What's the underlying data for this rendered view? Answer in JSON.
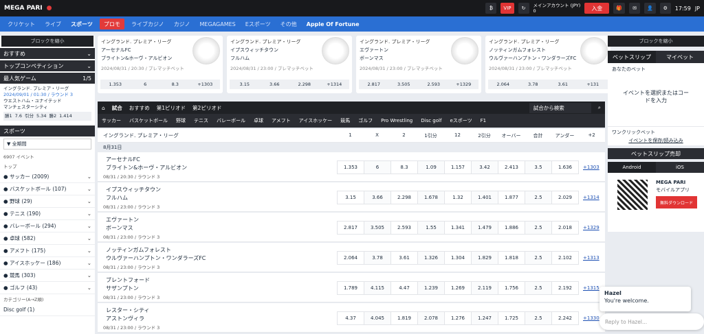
{
  "header": {
    "logo": "MEGA PARI",
    "vip": "VIP",
    "account_label": "メインアカウント (JPY)",
    "account_balance": "0",
    "deposit_button": "入金",
    "time": "17:59",
    "lang": "JP"
  },
  "nav": {
    "items": [
      "クリケット",
      "ライブ",
      "スポーツ",
      "プロモ",
      "ライブカジノ",
      "カジノ",
      "MEGAGAMES",
      "Eスポーツ",
      "その他",
      "Apple Of Fortune"
    ]
  },
  "left": {
    "collapse": "ブロックを縮小",
    "featured": "おすすめ",
    "top_comp": "トップコンペティション",
    "popular": "最人気ゲーム",
    "popular_pager": "1/5",
    "popular_match": {
      "league": "イングランド. プレミア・リーグ",
      "date": "2024/09/01 / 01:30 / ラウンド 3",
      "team1": "ウエストハム・ユナイテッド",
      "team2": "マンチェスターシティ",
      "odds": [
        [
          "勝1",
          "7.6"
        ],
        [
          "引分",
          "5.34"
        ],
        [
          "勝2",
          "1.414"
        ]
      ]
    },
    "sports_title": "スポーツ",
    "period_select": "全期間",
    "event_count": "6907 イベント",
    "top_label": "トップ",
    "sports": [
      "サッカー (2009)",
      "バスケットボール (107)",
      "野球 (29)",
      "テニス (190)",
      "バレーボール (294)",
      "卓球 (582)",
      "アメフト (175)",
      "アイスホッケー (186)",
      "競馬 (303)",
      "ゴルフ (43)"
    ],
    "category_label": "カテゴリー(A→Z順)",
    "disc_golf": "Disc golf (1)"
  },
  "cards": [
    {
      "league": "イングランド. プレミア・リーグ",
      "team1": "アーセナルFC",
      "team2": "ブライトン&ホーヴ・アルビオン",
      "dt": "2024/08/31 / 20:30 / プレマッチベット",
      "o1": "1.353",
      "ox": "6",
      "o2": "8.3",
      "more": "+1303"
    },
    {
      "league": "イングランド. プレミア・リーグ",
      "team1": "イプスウィッチタウン",
      "team2": "フルハム",
      "dt": "2024/08/31 / 23:00 / プレマッチベット",
      "o1": "3.15",
      "ox": "3.66",
      "o2": "2.298",
      "more": "+1314"
    },
    {
      "league": "イングランド. プレミア・リーグ",
      "team1": "エヴァートン",
      "team2": "ボーンマス",
      "dt": "2024/08/31 / 23:00 / プレマッチベット",
      "o1": "2.817",
      "ox": "3.505",
      "o2": "2.593",
      "more": "+1329"
    },
    {
      "league": "イングランド. プレミア・リーグ",
      "team1": "ノッティンガムフォレスト",
      "team2": "ウルヴァーハンプトン・ワンダラーズFC",
      "dt": "2024/08/31 / 23:00 / プレマッチベット",
      "o1": "2.064",
      "ox": "3.78",
      "o2": "3.61",
      "more": "+131"
    }
  ],
  "center": {
    "tabs": [
      "試合",
      "おすすめ",
      "第1ピリオド",
      "第2ピリオド"
    ],
    "search": "試合から検索",
    "sports": [
      "サッカー",
      "バスケットボール",
      "野球",
      "テニス",
      "バレーボール",
      "卓球",
      "アメフト",
      "アイスホッケー",
      "競馬",
      "ゴルフ",
      "Pro Wrestling",
      "Disc golf",
      "eスポーツ",
      "F1"
    ],
    "league": "イングランド. プレミア・リーグ",
    "cols": [
      "1",
      "X",
      "2",
      "1引分",
      "12",
      "2引分",
      "オーバー",
      "合計",
      "アンダー",
      "+2"
    ],
    "date": "8月31日",
    "matches": [
      {
        "t1": "アーセナルFC",
        "t2": "ブライトン&ホーヴ・アルビオン",
        "dt": "08/31 / 20:30 / ラウンド 3",
        "odds": [
          "1.353",
          "6",
          "8.3",
          "1.09",
          "1.157",
          "3.42",
          "2.413",
          "3.5",
          "1.636"
        ],
        "more": "+1303"
      },
      {
        "t1": "イプスウィッチタウン",
        "t2": "フルハム",
        "dt": "08/31 / 23:00 / ラウンド 3",
        "odds": [
          "3.15",
          "3.66",
          "2.298",
          "1.678",
          "1.32",
          "1.401",
          "1.877",
          "2.5",
          "2.029"
        ],
        "more": "+1314"
      },
      {
        "t1": "エヴァートン",
        "t2": "ボーンマス",
        "dt": "08/31 / 23:00 / ラウンド 3",
        "odds": [
          "2.817",
          "3.505",
          "2.593",
          "1.55",
          "1.341",
          "1.479",
          "1.886",
          "2.5",
          "2.018"
        ],
        "more": "+1329"
      },
      {
        "t1": "ノッティンガムフォレスト",
        "t2": "ウルヴァーハンプトン・ワンダラーズFC",
        "dt": "08/31 / 23:00 / ラウンド 3",
        "odds": [
          "2.064",
          "3.78",
          "3.61",
          "1.326",
          "1.304",
          "1.829",
          "1.818",
          "2.5",
          "2.102"
        ],
        "more": "+1313"
      },
      {
        "t1": "ブレントフォード",
        "t2": "サザンプトン",
        "dt": "08/31 / 23:00 / ラウンド 3",
        "odds": [
          "1.789",
          "4.115",
          "4.47",
          "1.239",
          "1.269",
          "2.119",
          "1.756",
          "2.5",
          "2.192"
        ],
        "more": "+1315"
      },
      {
        "t1": "レスター・シティ",
        "t2": "アストンヴィラ",
        "dt": "08/31 / 23:00 / ラウンド 3",
        "odds": [
          "4.37",
          "4.045",
          "1.819",
          "2.078",
          "1.276",
          "1.247",
          "1.725",
          "2.5",
          "2.242"
        ],
        "more": "+1330"
      }
    ]
  },
  "right": {
    "collapse": "ブロックを縮小",
    "tabs": [
      "ベットスリップ",
      "マイベット"
    ],
    "your_bets": "あなたのベット",
    "empty": "イベントを選択またはコードを入力",
    "one_click": "ワンクリックベット",
    "save_load": "イベントを保存/読み込み",
    "booking": "ベットスリップ売却",
    "android": "Android",
    "ios": "iOS",
    "app_brand": "MEGA PARI",
    "app_title": "モバイルアプリ",
    "download": "無料ダウンロード"
  },
  "chat": {
    "name": "Hazel",
    "message": "You're welcome.",
    "placeholder": "Reply to Hazel..."
  }
}
